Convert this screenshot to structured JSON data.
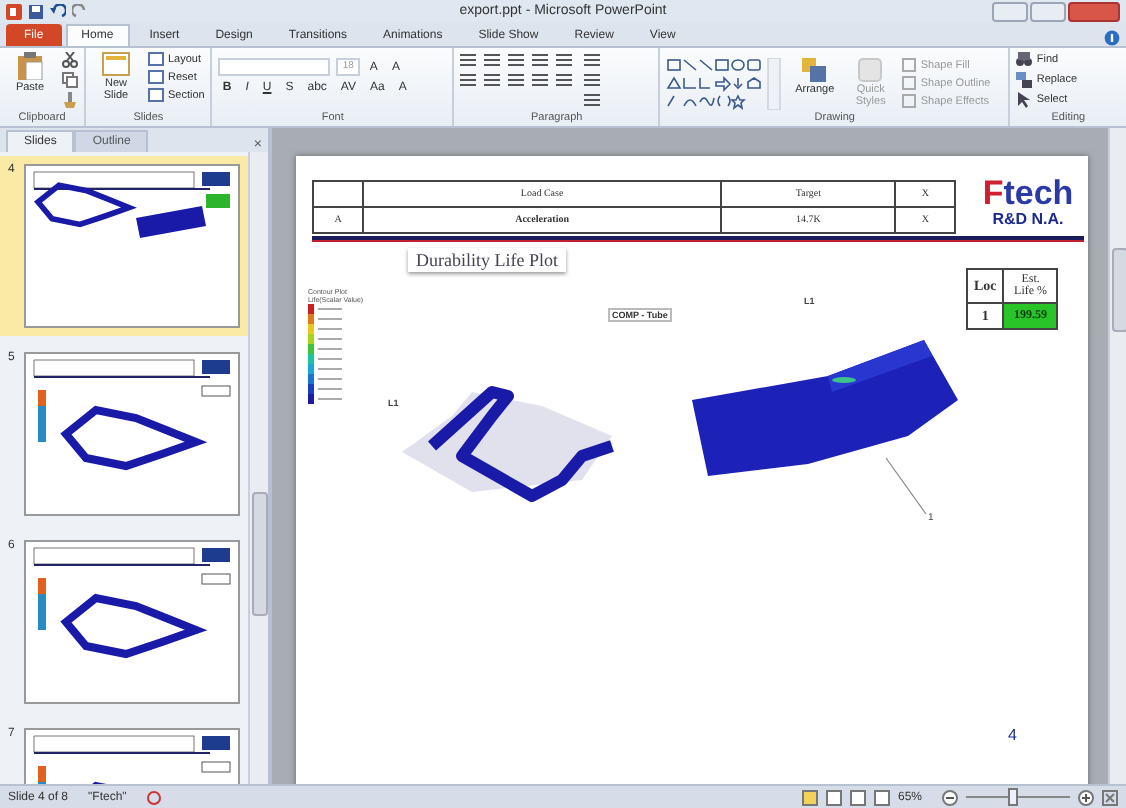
{
  "window": {
    "title": "export.ppt - Microsoft PowerPoint"
  },
  "ribbon_tabs": [
    {
      "label": "File",
      "kind": "file",
      "selected": false
    },
    {
      "label": "Home",
      "kind": "tab",
      "selected": true
    },
    {
      "label": "Insert",
      "kind": "tab",
      "selected": false
    },
    {
      "label": "Design",
      "kind": "tab",
      "selected": false
    },
    {
      "label": "Transitions",
      "kind": "tab",
      "selected": false
    },
    {
      "label": "Animations",
      "kind": "tab",
      "selected": false
    },
    {
      "label": "Slide Show",
      "kind": "tab",
      "selected": false
    },
    {
      "label": "Review",
      "kind": "tab",
      "selected": false
    },
    {
      "label": "View",
      "kind": "tab",
      "selected": false
    }
  ],
  "ribbon_groups": [
    {
      "label": "Clipboard",
      "kind": "clipboard",
      "controls": [
        "Paste"
      ]
    },
    {
      "label": "Slides",
      "kind": "slides",
      "controls": [
        "New Slide",
        "Layout",
        "Reset",
        "Section"
      ]
    },
    {
      "label": "Font",
      "kind": "font",
      "controls": [
        "18",
        "A",
        "A",
        "B",
        "I",
        "U",
        "S",
        "abc",
        "AV",
        "Aa",
        "A"
      ]
    },
    {
      "label": "Paragraph",
      "kind": "paragraph"
    },
    {
      "label": "Drawing",
      "kind": "drawing",
      "controls": [
        "Arrange",
        "Quick Styles",
        "Shape Fill",
        "Shape Outline",
        "Shape Effects"
      ]
    },
    {
      "label": "Editing",
      "kind": "editing",
      "controls": [
        "Find",
        "Replace",
        "Select"
      ]
    }
  ],
  "pane_close": "×",
  "pane_tabs": [
    {
      "label": "Slides",
      "selected": true
    },
    {
      "label": "Outline",
      "selected": false
    }
  ],
  "thumbnails": [
    {
      "number": "4",
      "kind": "two-view",
      "selected": true
    },
    {
      "number": "5",
      "kind": "frame-view",
      "selected": false
    },
    {
      "number": "6",
      "kind": "frame-view",
      "selected": false
    },
    {
      "number": "7",
      "kind": "frame-view",
      "selected": false
    }
  ],
  "slide": {
    "table": {
      "columns": [
        "",
        "Load Case",
        "Target",
        "X"
      ],
      "rows": [
        [
          "A",
          "Acceleration",
          "14.7K",
          "X"
        ]
      ]
    },
    "logo": {
      "brand": "Ftech",
      "subtitle": "R&D N.A."
    },
    "plot_title": "Durability Life Plot",
    "legend": {
      "title": "Contour Plot",
      "subtitle": "Life(Scalar Value)"
    },
    "view_label": "COMP - Tube",
    "location_labels": [
      "L1",
      "L1"
    ],
    "callout": "1",
    "life_table": {
      "columns": [
        "Loc",
        "Est. Life %"
      ],
      "rows": [
        [
          "1",
          "199.59"
        ]
      ]
    },
    "page_number": "4"
  },
  "status_bar": {
    "slide": "Slide 4 of 8",
    "theme": "\"Ftech\"",
    "zoom": "65%",
    "level": 0.45
  }
}
